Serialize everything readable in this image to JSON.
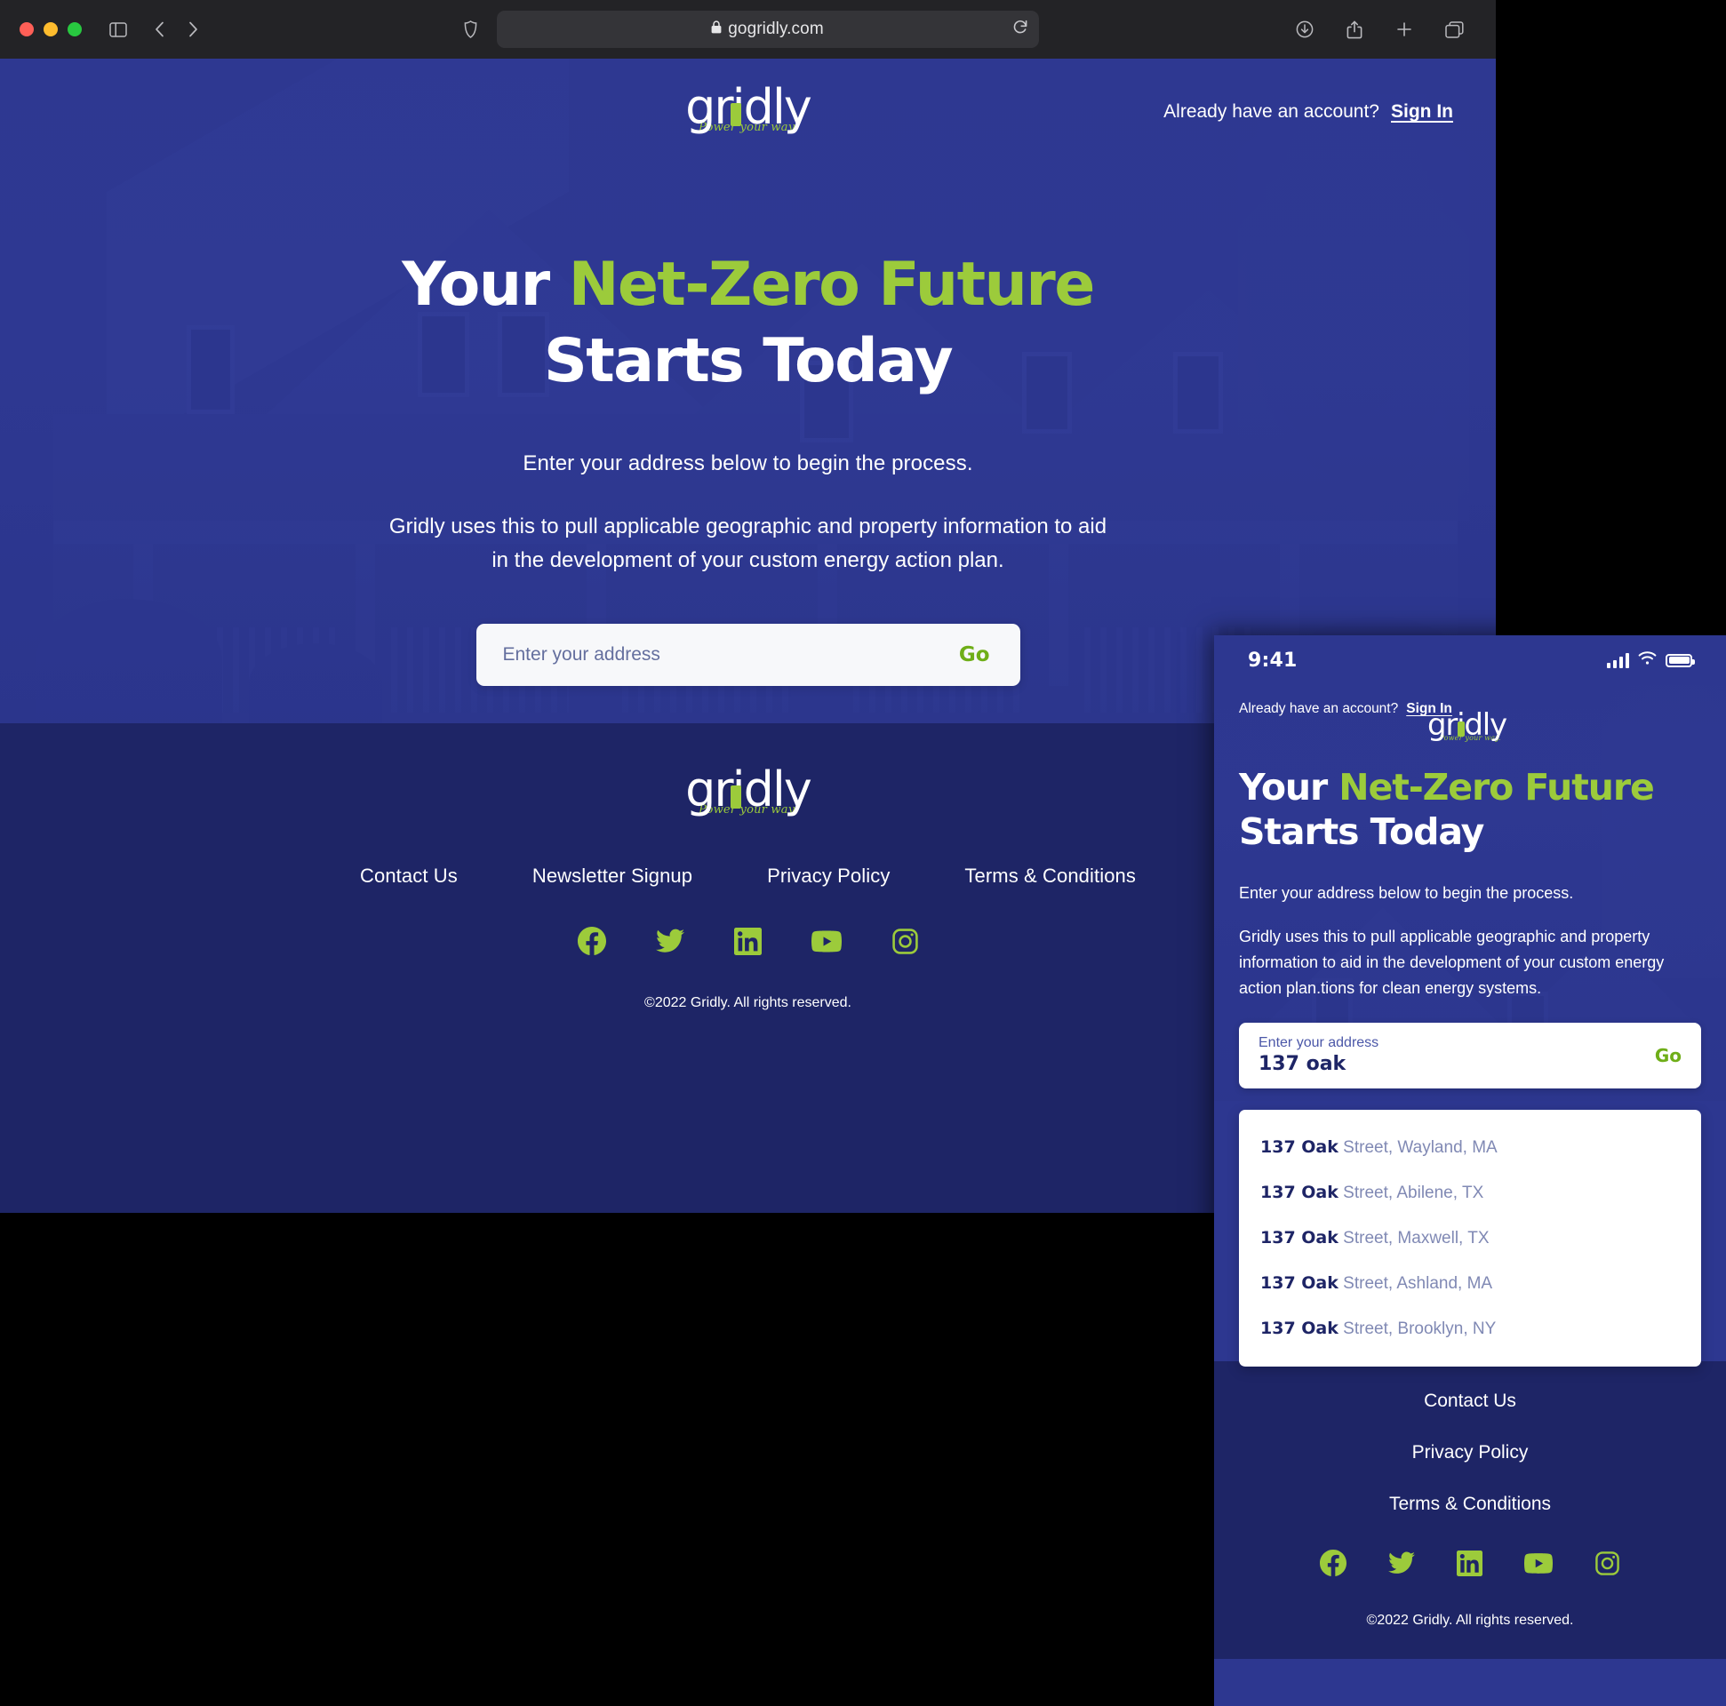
{
  "browser": {
    "url": "gogridly.com",
    "lock_icon": "lock-icon",
    "reload_icon": "reload-icon",
    "back_icon": "back-chevron-icon",
    "forward_icon": "forward-chevron-icon",
    "sidebar_icon": "sidebar-toggle-icon",
    "shield_icon": "privacy-shield-icon",
    "download_icon": "download-icon",
    "share_icon": "share-icon",
    "new_tab_icon": "plus-icon",
    "tab_overview_icon": "tab-overview-icon"
  },
  "brand": {
    "wordmark": "gridly",
    "tagline": "Power your way.",
    "accent_green": "#9ccb3b",
    "primary_blue": "#2d3790",
    "footer_blue": "#1e2566",
    "go_green": "#6fae18"
  },
  "desktop": {
    "header": {
      "account_prompt": "Already have an account?",
      "sign_in": "Sign In"
    },
    "hero": {
      "headline_part1": "Your ",
      "headline_accent": "Net-Zero Future",
      "headline_part2": "Starts Today",
      "sub_1": "Enter your address below to begin the process.",
      "sub_2": "Gridly uses this to pull applicable geographic and property information to aid in the development of your custom energy action plan.",
      "search_placeholder": "Enter your address",
      "search_value": "",
      "go_label": "Go"
    },
    "footer": {
      "links": [
        "Contact Us",
        "Newsletter Signup",
        "Privacy Policy",
        "Terms & Conditions"
      ],
      "socials": [
        "facebook-icon",
        "twitter-icon",
        "linkedin-icon",
        "youtube-icon",
        "instagram-icon"
      ],
      "copyright": "©2022 Gridly. All rights reserved."
    }
  },
  "mobile": {
    "status": {
      "time": "9:41",
      "cellular_icon": "cellular-bars-icon",
      "wifi_icon": "wifi-icon",
      "battery_icon": "battery-icon"
    },
    "header": {
      "account_prompt": "Already have an account?",
      "sign_in": "Sign In"
    },
    "hero": {
      "headline_part1": "Your ",
      "headline_accent": "Net-Zero Future",
      "headline_part2": "Starts Today",
      "sub_1": "Enter your address below to begin the process.",
      "sub_2": "Gridly uses this to pull applicable geographic and property information to aid in the development of your custom energy action plan.tions for clean energy systems.",
      "field_label": "Enter your address",
      "field_value": "137 oak",
      "go_label": "Go"
    },
    "suggestions": [
      {
        "match": "137 Oak",
        "rest": " Street, Wayland, MA"
      },
      {
        "match": "137 Oak",
        "rest": " Street, Abilene, TX"
      },
      {
        "match": "137 Oak",
        "rest": " Street, Maxwell, TX"
      },
      {
        "match": "137 Oak",
        "rest": " Street, Ashland, MA"
      },
      {
        "match": "137 Oak",
        "rest": " Street, Brooklyn, NY"
      }
    ],
    "footer": {
      "links": [
        "Contact Us",
        "Privacy Policy",
        "Terms & Conditions"
      ],
      "socials": [
        "facebook-icon",
        "twitter-icon",
        "linkedin-icon",
        "youtube-icon",
        "instagram-icon"
      ],
      "copyright": "©2022 Gridly. All rights reserved."
    }
  }
}
